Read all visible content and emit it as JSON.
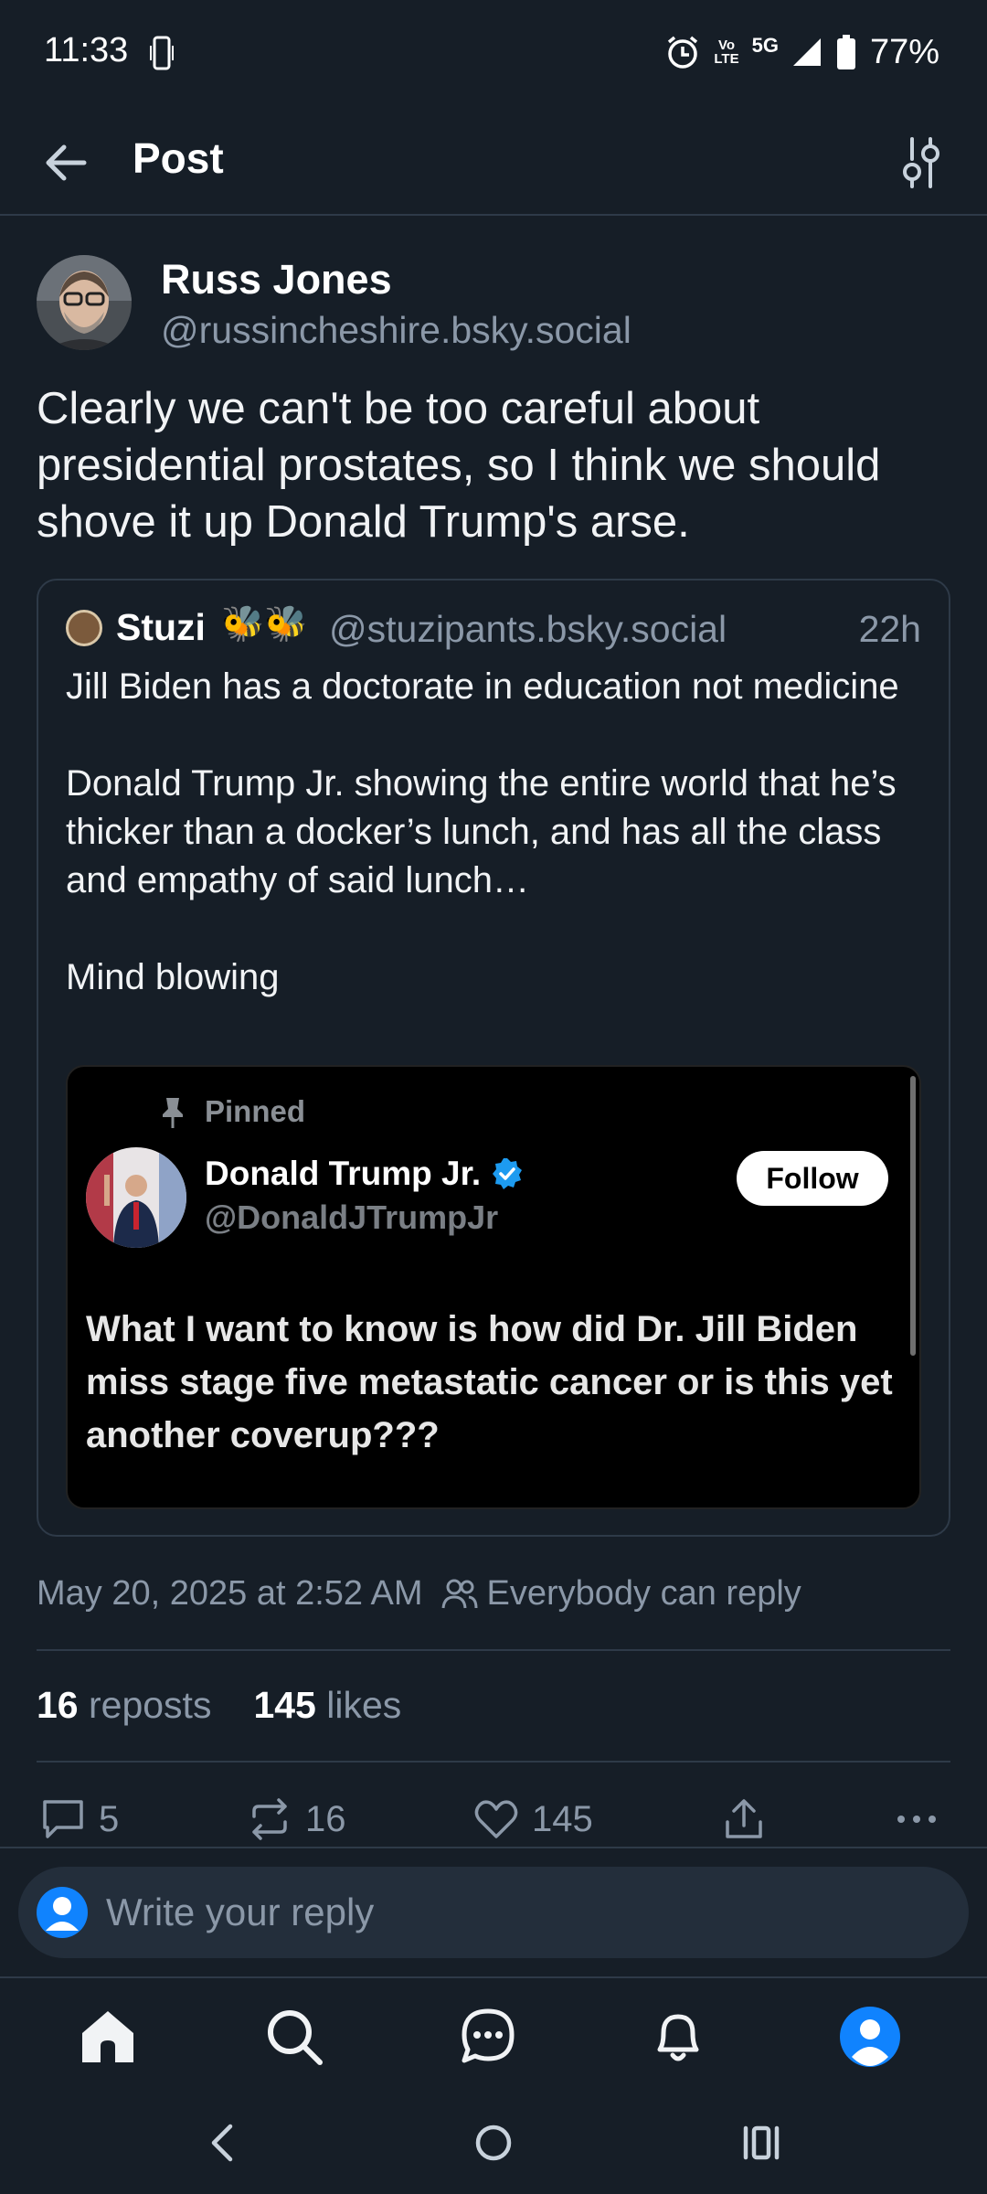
{
  "status_bar": {
    "time": "11:33",
    "battery": "77%",
    "network": "5G",
    "volte_line1": "Vo",
    "volte_line2": "LTE"
  },
  "header": {
    "title": "Post"
  },
  "post": {
    "author_name": "Russ Jones",
    "author_handle": "@russincheshire.bsky.social",
    "text": "Clearly we can't be too careful about presidential prostates, so I think we should shove it up Donald Trump's arse.",
    "quote": {
      "author_name": "Stuzi",
      "author_emoji": "🐝🐝",
      "author_handle": "@stuzipants.bsky.social",
      "time": "22h",
      "text": "Jill Biden has a doctorate in education not medicine\n\nDonald Trump Jr. showing the entire world that he’s thicker than a docker’s lunch, and has all the class and empathy of said lunch…\n\nMind blowing",
      "embed": {
        "pinned_label": "Pinned",
        "name": "Donald Trump Jr.",
        "handle": "@DonaldJTrumpJr",
        "follow_label": "Follow",
        "text": "What I want to know is how did Dr. Jill Biden miss stage five metastatic cancer or is this yet another coverup???"
      }
    },
    "timestamp": "May 20, 2025 at 2:52 AM",
    "reply_setting": "Everybody can reply",
    "reposts_count": "16",
    "reposts_label": " reposts",
    "likes_count": "145",
    "likes_label": " likes"
  },
  "actions": {
    "replies": "5",
    "reposts": "16",
    "likes": "145"
  },
  "reply_bar": {
    "placeholder": "Write your reply"
  },
  "icons": {
    "back": "arrow-left-icon",
    "filter": "sliders-icon",
    "reply": "speech-bubble-icon",
    "repost": "repost-arrows-icon",
    "like": "heart-icon",
    "share": "share-upload-icon",
    "more": "ellipsis-icon"
  },
  "colors": {
    "background": "#161e27",
    "accent": "#1083fe",
    "muted_text": "#8b98a8",
    "border": "#2e3a48"
  }
}
